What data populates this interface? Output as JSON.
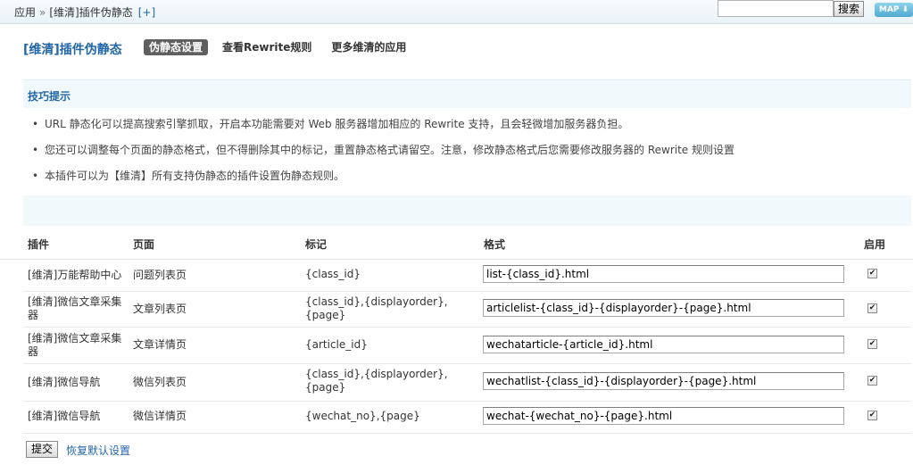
{
  "breadcrumb": {
    "root": "应用",
    "separator": "»",
    "current": "[维清]插件伪静态",
    "add": "[+]"
  },
  "search": {
    "value": "",
    "button": "搜索"
  },
  "map_button": "MAP",
  "page_title": "[维清]插件伪静态",
  "tabs": [
    "伪静态设置",
    "查看Rewrite规则",
    "更多维清的应用"
  ],
  "tips": {
    "title": "技巧提示",
    "items": [
      "URL 静态化可以提高搜索引擎抓取，开启本功能需要对 Web 服务器增加相应的 Rewrite 支持，且会轻微增加服务器负担。",
      "您还可以调整每个页面的静态格式，但不得删除其中的标记，重置静态格式请留空。注意，修改静态格式后您需要修改服务器的 Rewrite 规则设置",
      "本插件可以为【维清】所有支持伪静态的插件设置伪静态规则。"
    ]
  },
  "table": {
    "headers": [
      "插件",
      "页面",
      "标记",
      "格式",
      "启用"
    ],
    "rows": [
      {
        "plugin": "[维清]万能帮助中心",
        "page": "问题列表页",
        "tags": "{class_id}",
        "format": "list-{class_id}.html",
        "enabled": true
      },
      {
        "plugin": "[维清]微信文章采集器",
        "page": "文章列表页",
        "tags": "{class_id},{displayorder},{page}",
        "format": "articlelist-{class_id}-{displayorder}-{page}.html",
        "enabled": true
      },
      {
        "plugin": "[维清]微信文章采集器",
        "page": "文章详情页",
        "tags": "{article_id}",
        "format": "wechatarticle-{article_id}.html",
        "enabled": true
      },
      {
        "plugin": "[维清]微信导航",
        "page": "微信列表页",
        "tags": "{class_id},{displayorder},{page}",
        "format": "wechatlist-{class_id}-{displayorder}-{page}.html",
        "enabled": true
      },
      {
        "plugin": "[维清]微信导航",
        "page": "微信详情页",
        "tags": "{wechat_no},{page}",
        "format": "wechat-{wechat_no}-{page}.html",
        "enabled": true
      }
    ]
  },
  "buttons": {
    "submit": "提交",
    "reset": "恢复默认设置"
  },
  "colors": {
    "link": "#2366a8",
    "tips_bg": "#f2f9fd",
    "active_tab": "#5f5f5f"
  }
}
